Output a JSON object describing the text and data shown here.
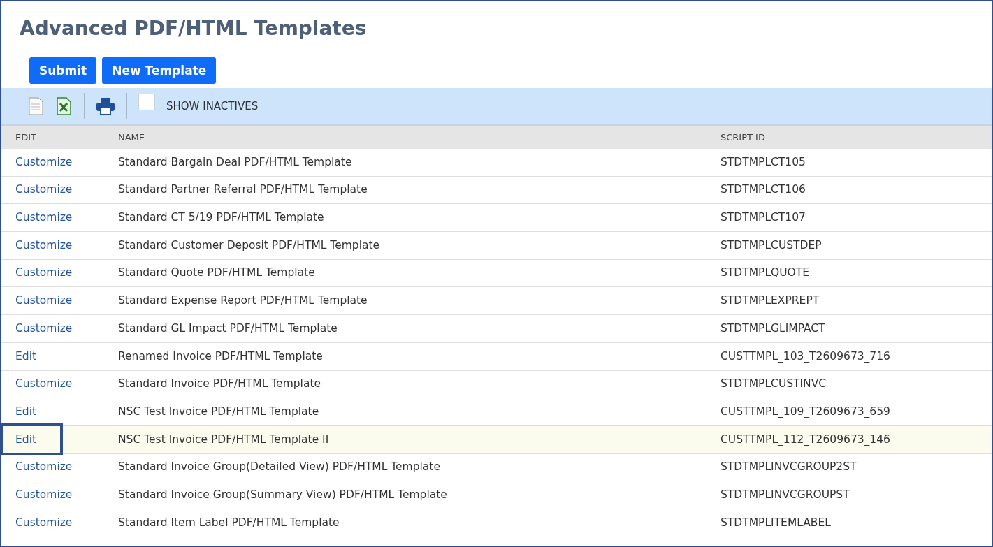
{
  "title": "Advanced PDF/HTML Templates",
  "buttons": [
    "Submit",
    "New Template"
  ],
  "toolbar": {
    "show_inactives": {
      "label": "SHOW INACTIVES",
      "checked": false
    }
  },
  "table": {
    "columns": [
      "EDIT",
      "NAME",
      "SCRIPT ID"
    ],
    "rows": [
      {
        "edit": "Customize",
        "name": "Standard Bargain Deal PDF/HTML Template",
        "script_id": "STDTMPLCT105",
        "selected": false
      },
      {
        "edit": "Customize",
        "name": "Standard Partner Referral PDF/HTML Template",
        "script_id": "STDTMPLCT106",
        "selected": false
      },
      {
        "edit": "Customize",
        "name": "Standard CT 5/19 PDF/HTML Template",
        "script_id": "STDTMPLCT107",
        "selected": false
      },
      {
        "edit": "Customize",
        "name": "Standard Customer Deposit PDF/HTML Template",
        "script_id": "STDTMPLCUSTDEP",
        "selected": false
      },
      {
        "edit": "Customize",
        "name": "Standard Quote PDF/HTML Template",
        "script_id": "STDTMPLQUOTE",
        "selected": false
      },
      {
        "edit": "Customize",
        "name": "Standard Expense Report PDF/HTML Template",
        "script_id": "STDTMPLEXPREPT",
        "selected": false
      },
      {
        "edit": "Customize",
        "name": "Standard GL Impact PDF/HTML Template",
        "script_id": "STDTMPLGLIMPACT",
        "selected": false
      },
      {
        "edit": "Edit",
        "name": "Renamed Invoice PDF/HTML Template",
        "script_id": "CUSTTMPL_103_T2609673_716",
        "selected": false
      },
      {
        "edit": "Customize",
        "name": "Standard Invoice PDF/HTML Template",
        "script_id": "STDTMPLCUSTINVC",
        "selected": false
      },
      {
        "edit": "Edit",
        "name": "NSC Test Invoice PDF/HTML Template",
        "script_id": "CUSTTMPL_109_T2609673_659",
        "selected": false
      },
      {
        "edit": "Edit",
        "name": "NSC Test Invoice PDF/HTML Template II",
        "script_id": "CUSTTMPL_112_T2609673_146",
        "selected": true
      },
      {
        "edit": "Customize",
        "name": "Standard Invoice Group(Detailed View) PDF/HTML Template",
        "script_id": "STDTMPLINVCGROUP2ST",
        "selected": false
      },
      {
        "edit": "Customize",
        "name": "Standard Invoice Group(Summary View) PDF/HTML Template",
        "script_id": "STDTMPLINVCGROUPST",
        "selected": false
      },
      {
        "edit": "Customize",
        "name": "Standard Item Label PDF/HTML Template",
        "script_id": "STDTMPLITEMLABEL",
        "selected": false
      }
    ]
  }
}
